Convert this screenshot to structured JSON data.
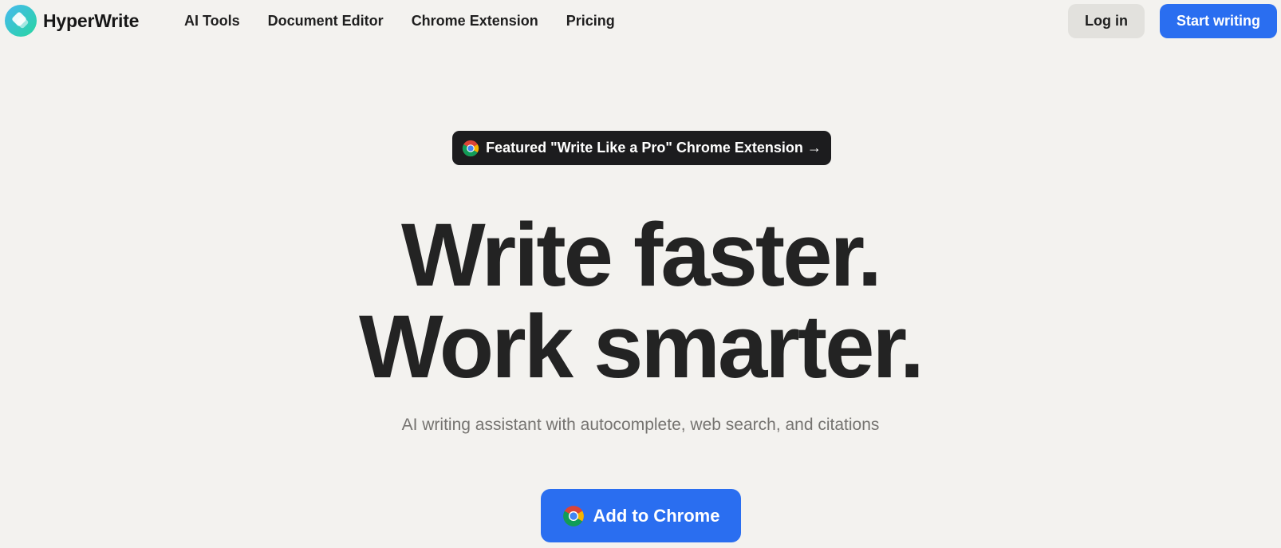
{
  "brand": {
    "name": "HyperWrite",
    "logo_icon": "hyperwrite-logo-icon",
    "logo_colors": [
      "#3ec6e8",
      "#2fd6a8"
    ]
  },
  "nav": {
    "items": [
      {
        "label": "AI Tools"
      },
      {
        "label": "Document Editor"
      },
      {
        "label": "Chrome Extension"
      },
      {
        "label": "Pricing"
      }
    ]
  },
  "header_actions": {
    "login_label": "Log in",
    "start_label": "Start writing"
  },
  "hero": {
    "badge": {
      "icon": "chrome-icon",
      "text": "Featured \"Write Like a Pro\" Chrome Extension",
      "arrow": "→"
    },
    "title_line_1": "Write faster.",
    "title_line_2": "Work smarter.",
    "subtitle": "AI writing assistant with autocomplete, web search, and citations",
    "cta": {
      "icon": "chrome-icon",
      "label": "Add to Chrome"
    }
  },
  "colors": {
    "background": "#f3f2ef",
    "accent": "#2a6ef0",
    "badge_background": "#1c1c1e",
    "heading": "#232323",
    "muted_text": "#757370",
    "login_button": "#e2e1dd"
  }
}
